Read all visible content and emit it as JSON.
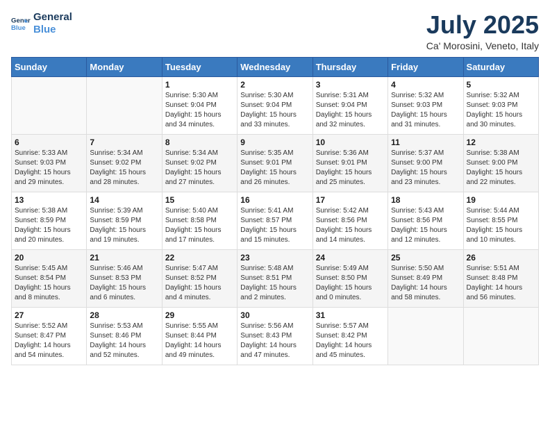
{
  "logo": {
    "line1": "General",
    "line2": "Blue"
  },
  "title": "July 2025",
  "subtitle": "Ca' Morosini, Veneto, Italy",
  "weekdays": [
    "Sunday",
    "Monday",
    "Tuesday",
    "Wednesday",
    "Thursday",
    "Friday",
    "Saturday"
  ],
  "weeks": [
    [
      {
        "day": "",
        "sunrise": "",
        "sunset": "",
        "daylight": ""
      },
      {
        "day": "",
        "sunrise": "",
        "sunset": "",
        "daylight": ""
      },
      {
        "day": "1",
        "sunrise": "Sunrise: 5:30 AM",
        "sunset": "Sunset: 9:04 PM",
        "daylight": "Daylight: 15 hours and 34 minutes."
      },
      {
        "day": "2",
        "sunrise": "Sunrise: 5:30 AM",
        "sunset": "Sunset: 9:04 PM",
        "daylight": "Daylight: 15 hours and 33 minutes."
      },
      {
        "day": "3",
        "sunrise": "Sunrise: 5:31 AM",
        "sunset": "Sunset: 9:04 PM",
        "daylight": "Daylight: 15 hours and 32 minutes."
      },
      {
        "day": "4",
        "sunrise": "Sunrise: 5:32 AM",
        "sunset": "Sunset: 9:03 PM",
        "daylight": "Daylight: 15 hours and 31 minutes."
      },
      {
        "day": "5",
        "sunrise": "Sunrise: 5:32 AM",
        "sunset": "Sunset: 9:03 PM",
        "daylight": "Daylight: 15 hours and 30 minutes."
      }
    ],
    [
      {
        "day": "6",
        "sunrise": "Sunrise: 5:33 AM",
        "sunset": "Sunset: 9:03 PM",
        "daylight": "Daylight: 15 hours and 29 minutes."
      },
      {
        "day": "7",
        "sunrise": "Sunrise: 5:34 AM",
        "sunset": "Sunset: 9:02 PM",
        "daylight": "Daylight: 15 hours and 28 minutes."
      },
      {
        "day": "8",
        "sunrise": "Sunrise: 5:34 AM",
        "sunset": "Sunset: 9:02 PM",
        "daylight": "Daylight: 15 hours and 27 minutes."
      },
      {
        "day": "9",
        "sunrise": "Sunrise: 5:35 AM",
        "sunset": "Sunset: 9:01 PM",
        "daylight": "Daylight: 15 hours and 26 minutes."
      },
      {
        "day": "10",
        "sunrise": "Sunrise: 5:36 AM",
        "sunset": "Sunset: 9:01 PM",
        "daylight": "Daylight: 15 hours and 25 minutes."
      },
      {
        "day": "11",
        "sunrise": "Sunrise: 5:37 AM",
        "sunset": "Sunset: 9:00 PM",
        "daylight": "Daylight: 15 hours and 23 minutes."
      },
      {
        "day": "12",
        "sunrise": "Sunrise: 5:38 AM",
        "sunset": "Sunset: 9:00 PM",
        "daylight": "Daylight: 15 hours and 22 minutes."
      }
    ],
    [
      {
        "day": "13",
        "sunrise": "Sunrise: 5:38 AM",
        "sunset": "Sunset: 8:59 PM",
        "daylight": "Daylight: 15 hours and 20 minutes."
      },
      {
        "day": "14",
        "sunrise": "Sunrise: 5:39 AM",
        "sunset": "Sunset: 8:59 PM",
        "daylight": "Daylight: 15 hours and 19 minutes."
      },
      {
        "day": "15",
        "sunrise": "Sunrise: 5:40 AM",
        "sunset": "Sunset: 8:58 PM",
        "daylight": "Daylight: 15 hours and 17 minutes."
      },
      {
        "day": "16",
        "sunrise": "Sunrise: 5:41 AM",
        "sunset": "Sunset: 8:57 PM",
        "daylight": "Daylight: 15 hours and 15 minutes."
      },
      {
        "day": "17",
        "sunrise": "Sunrise: 5:42 AM",
        "sunset": "Sunset: 8:56 PM",
        "daylight": "Daylight: 15 hours and 14 minutes."
      },
      {
        "day": "18",
        "sunrise": "Sunrise: 5:43 AM",
        "sunset": "Sunset: 8:56 PM",
        "daylight": "Daylight: 15 hours and 12 minutes."
      },
      {
        "day": "19",
        "sunrise": "Sunrise: 5:44 AM",
        "sunset": "Sunset: 8:55 PM",
        "daylight": "Daylight: 15 hours and 10 minutes."
      }
    ],
    [
      {
        "day": "20",
        "sunrise": "Sunrise: 5:45 AM",
        "sunset": "Sunset: 8:54 PM",
        "daylight": "Daylight: 15 hours and 8 minutes."
      },
      {
        "day": "21",
        "sunrise": "Sunrise: 5:46 AM",
        "sunset": "Sunset: 8:53 PM",
        "daylight": "Daylight: 15 hours and 6 minutes."
      },
      {
        "day": "22",
        "sunrise": "Sunrise: 5:47 AM",
        "sunset": "Sunset: 8:52 PM",
        "daylight": "Daylight: 15 hours and 4 minutes."
      },
      {
        "day": "23",
        "sunrise": "Sunrise: 5:48 AM",
        "sunset": "Sunset: 8:51 PM",
        "daylight": "Daylight: 15 hours and 2 minutes."
      },
      {
        "day": "24",
        "sunrise": "Sunrise: 5:49 AM",
        "sunset": "Sunset: 8:50 PM",
        "daylight": "Daylight: 15 hours and 0 minutes."
      },
      {
        "day": "25",
        "sunrise": "Sunrise: 5:50 AM",
        "sunset": "Sunset: 8:49 PM",
        "daylight": "Daylight: 14 hours and 58 minutes."
      },
      {
        "day": "26",
        "sunrise": "Sunrise: 5:51 AM",
        "sunset": "Sunset: 8:48 PM",
        "daylight": "Daylight: 14 hours and 56 minutes."
      }
    ],
    [
      {
        "day": "27",
        "sunrise": "Sunrise: 5:52 AM",
        "sunset": "Sunset: 8:47 PM",
        "daylight": "Daylight: 14 hours and 54 minutes."
      },
      {
        "day": "28",
        "sunrise": "Sunrise: 5:53 AM",
        "sunset": "Sunset: 8:46 PM",
        "daylight": "Daylight: 14 hours and 52 minutes."
      },
      {
        "day": "29",
        "sunrise": "Sunrise: 5:55 AM",
        "sunset": "Sunset: 8:44 PM",
        "daylight": "Daylight: 14 hours and 49 minutes."
      },
      {
        "day": "30",
        "sunrise": "Sunrise: 5:56 AM",
        "sunset": "Sunset: 8:43 PM",
        "daylight": "Daylight: 14 hours and 47 minutes."
      },
      {
        "day": "31",
        "sunrise": "Sunrise: 5:57 AM",
        "sunset": "Sunset: 8:42 PM",
        "daylight": "Daylight: 14 hours and 45 minutes."
      },
      {
        "day": "",
        "sunrise": "",
        "sunset": "",
        "daylight": ""
      },
      {
        "day": "",
        "sunrise": "",
        "sunset": "",
        "daylight": ""
      }
    ]
  ]
}
